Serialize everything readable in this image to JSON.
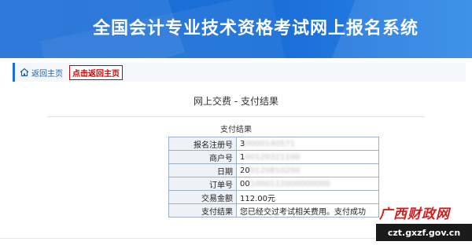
{
  "header": {
    "title": "全国会计专业技术资格考试网上报名系统"
  },
  "breadcrumb": {
    "home_label": "返回主页",
    "back_badge": "点击返回主页"
  },
  "page": {
    "title": "网上交费 - 支付结果",
    "section_title": "支付结果"
  },
  "result": {
    "rows": [
      {
        "label": "报名注册号",
        "value": "3",
        "masked": "0000140571"
      },
      {
        "label": "商户号",
        "value": "1",
        "masked": "00120321100"
      },
      {
        "label": "日期",
        "value": "20",
        "masked": "0120810200"
      },
      {
        "label": "订单号",
        "value": "00",
        "masked": "1000122000000000"
      },
      {
        "label": "交易金额",
        "value": "112.00元",
        "masked": ""
      },
      {
        "label": "支付结果",
        "value": "您已经交过考试相关费用。支付成功",
        "masked": ""
      }
    ]
  },
  "watermark": {
    "name": "广西财政网",
    "url": "czt.gxzf.gov.cn"
  },
  "colors": {
    "banner_blue": "#1a6fd8",
    "badge_red": "#cc0000",
    "table_border": "#9bb0c8"
  },
  "icons": {
    "home": "home-icon"
  }
}
